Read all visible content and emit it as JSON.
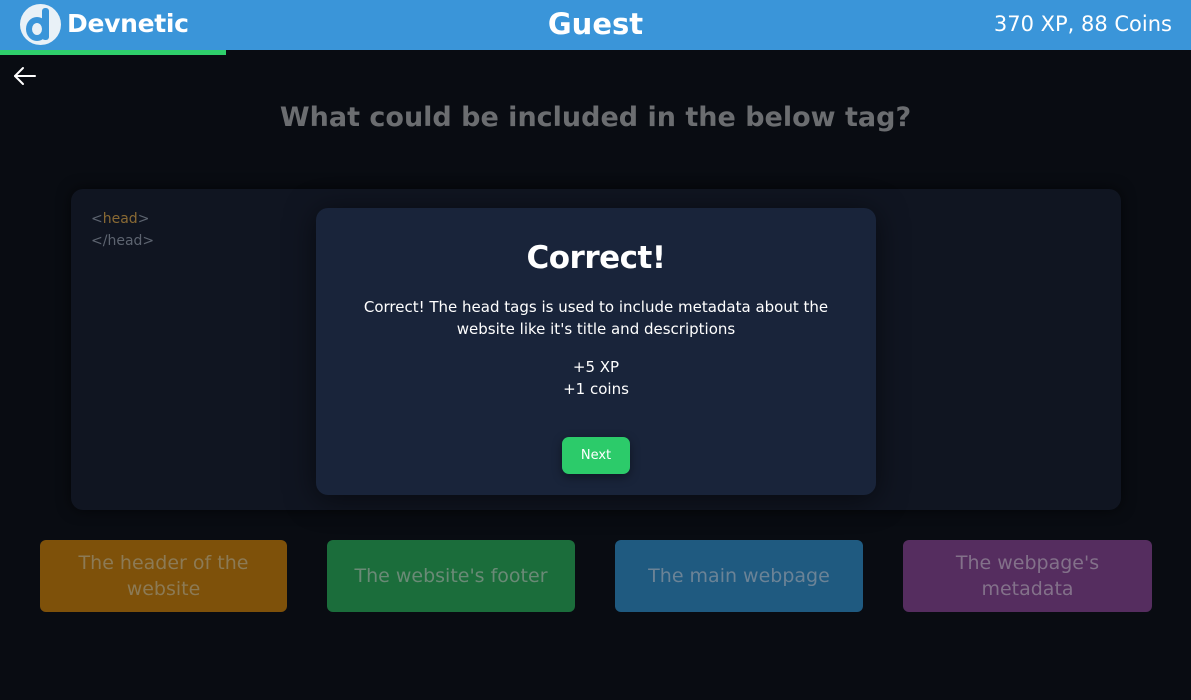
{
  "header": {
    "brand": "Devnetic",
    "user": "Guest",
    "stats": "370 XP, 88 Coins",
    "lesson_progress": 0.19,
    "colors": {
      "bar": "#3a95d9",
      "progress": "#2fcf6b"
    }
  },
  "nav": {
    "back_icon": "arrow-left-icon"
  },
  "question": {
    "text": "What could be included in the below tag?",
    "code": {
      "open_prefix": "<",
      "open_tag": "head",
      "open_suffix": ">",
      "close_prefix": "</",
      "close_tag": "head",
      "close_suffix": ">"
    }
  },
  "answers": [
    {
      "label": "The header of the website",
      "color": "#7e510a"
    },
    {
      "label": "The website's footer",
      "color": "#1b6d3b"
    },
    {
      "label": "The main webpage",
      "color": "#1f5a80"
    },
    {
      "label": "The webpage's metadata",
      "color": "#552d5f"
    }
  ],
  "modal": {
    "title": "Correct!",
    "message": "Correct! The head tags is used to include metadata about the website like it's title and descriptions",
    "reward_xp": "+5 XP",
    "reward_coins": "+1 coins",
    "next_label": "Next",
    "next_color": "#2ccb6a"
  }
}
